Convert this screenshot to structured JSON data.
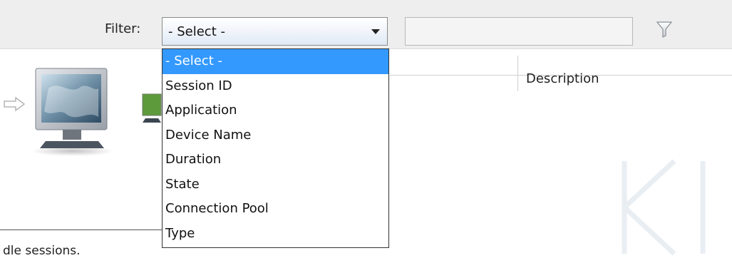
{
  "filter": {
    "label": "Filter:",
    "selected": "- Select -",
    "text_value": "",
    "options": [
      "- Select -",
      "Session ID",
      "Application",
      "Device Name",
      "Duration",
      "State",
      "Connection Pool",
      "Type"
    ],
    "selected_index": 0,
    "highlight_color": "#3399ff"
  },
  "table": {
    "columns": [
      "Description"
    ]
  },
  "status": {
    "text": "dle sessions."
  },
  "icons": {
    "filter": "funnel-icon",
    "arrow": "right-arrow-icon",
    "monitor": "monitor-icon"
  }
}
